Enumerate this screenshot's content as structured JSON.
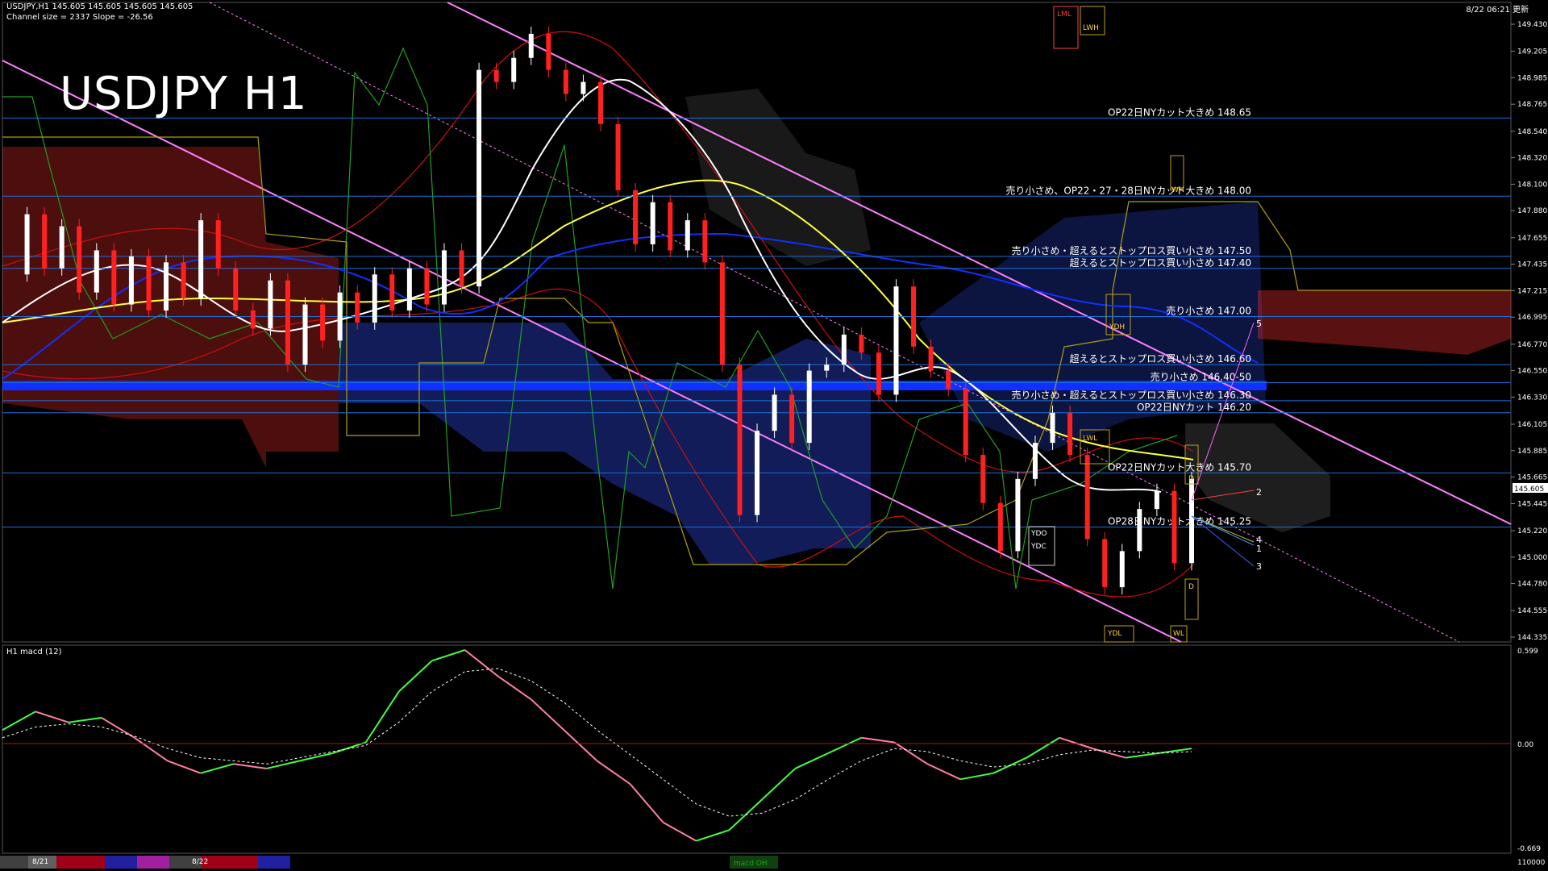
{
  "header": {
    "symbol_line": "USDJPY,H1  145.605 145.605 145.605 145.605",
    "channel_line": "Channel size = 2337 Slope = -26.56",
    "timestamp": "8/22 06:21 更新",
    "title": "USDJPY H1"
  },
  "macd_panel": {
    "label": "H1  macd (12)",
    "top_value": "0.599",
    "zero_value": "0.00",
    "bottom_value": "-0.669",
    "bottom_right": "110000"
  },
  "dates": [
    "8/21",
    "8/22"
  ],
  "strip_label": "macd OH",
  "colors": {
    "background": "#000000",
    "bull_candle": "#ffffff",
    "bear_candle": "#ff2020",
    "level_line": "#1e6fd8",
    "channel_line": "#ff80ff",
    "ma_white": "#ffffff",
    "ma_yellow": "#ffff40",
    "ma_blue": "#1030ff",
    "macd_up": "#40ff40",
    "macd_down": "#ff80a0",
    "signal": "#ffffff"
  },
  "chart_data": [
    {
      "type": "line",
      "title": "USDJPY H1",
      "y_axis_ticks": [
        "149.430",
        "149.205",
        "148.985",
        "148.765",
        "148.540",
        "148.320",
        "148.100",
        "147.880",
        "147.655",
        "147.435",
        "147.215",
        "146.995",
        "146.770",
        "146.550",
        "146.330",
        "146.105",
        "145.885",
        "145.665",
        "145.445",
        "145.220",
        "145.000",
        "144.780",
        "144.555",
        "144.335"
      ],
      "current_price": "145.605",
      "ylim": [
        144.335,
        149.43
      ],
      "price_path": [
        147.35,
        147.85,
        147.4,
        147.75,
        147.2,
        147.55,
        147.1,
        147.5,
        147.05,
        147.45,
        147.15,
        147.8,
        147.4,
        147.05,
        146.9,
        147.3,
        146.6,
        147.1,
        146.8,
        147.2,
        146.95,
        147.35,
        147.05,
        147.4,
        147.1,
        147.55,
        147.25,
        149.05,
        148.95,
        149.15,
        149.35,
        149.05,
        148.85,
        148.95,
        148.6,
        148.05,
        147.6,
        147.95,
        147.55,
        147.8,
        147.45,
        146.6,
        145.35,
        146.05,
        146.35,
        145.95,
        146.55,
        146.6,
        146.85,
        146.7,
        146.35,
        147.25,
        146.75,
        146.55,
        146.4,
        145.85,
        145.45,
        145.05,
        145.65,
        145.95,
        146.2,
        145.85,
        145.15,
        144.75,
        145.05,
        145.4,
        145.55,
        144.95,
        145.65
      ],
      "levels": [
        {
          "label": "OP22日NYカット大きめ 148.65",
          "value": 148.65
        },
        {
          "label": "売り小さめ、OP22・27・28日NYカット大きめ 148.00",
          "value": 148.0
        },
        {
          "label": "売り小さめ・超えるとストップロス買い小さめ 147.50",
          "value": 147.5
        },
        {
          "label": "超えるとストップロス買い小さめ 147.40",
          "value": 147.4
        },
        {
          "label": "売り小さめ 147.00",
          "value": 147.0
        },
        {
          "label": "超えるとストップロス買い小さめ 146.60",
          "value": 146.6
        },
        {
          "label": "売り小さめ 146.40-50",
          "value": 146.45
        },
        {
          "label": "売り小さめ・超えるとストップロス買い小さめ 146.30",
          "value": 146.3
        },
        {
          "label": "OP22日NYカット 146.20",
          "value": 146.2
        },
        {
          "label": "OP22日NYカット大きめ 145.70",
          "value": 145.7
        },
        {
          "label": "OP28日NYカット大きめ 145.25",
          "value": 145.25
        }
      ],
      "markers": [
        "LML",
        "LWH",
        "WH",
        "YDH",
        "LWL",
        "YDO",
        "YDC",
        "YDL",
        "WL",
        "D",
        "D"
      ],
      "projection_labels": [
        "1",
        "2",
        "3",
        "4",
        "5"
      ]
    },
    {
      "type": "line",
      "title": "H1  macd (12)",
      "ylim": [
        -0.669,
        0.599
      ],
      "macd_path": [
        0.1,
        0.22,
        0.15,
        0.18,
        0.05,
        -0.1,
        -0.18,
        -0.12,
        -0.15,
        -0.1,
        -0.05,
        0.02,
        0.35,
        0.55,
        0.62,
        0.45,
        0.3,
        0.1,
        -0.1,
        -0.25,
        -0.5,
        -0.62,
        -0.55,
        -0.35,
        -0.15,
        -0.05,
        0.05,
        0.02,
        -0.12,
        -0.22,
        -0.18,
        -0.08,
        0.05,
        -0.02,
        -0.08,
        -0.05,
        -0.02
      ],
      "signal_path": [
        0.05,
        0.12,
        0.14,
        0.12,
        0.06,
        -0.02,
        -0.08,
        -0.1,
        -0.12,
        -0.08,
        -0.04,
        0.0,
        0.15,
        0.35,
        0.48,
        0.5,
        0.42,
        0.28,
        0.1,
        -0.06,
        -0.22,
        -0.38,
        -0.46,
        -0.44,
        -0.35,
        -0.22,
        -0.1,
        -0.02,
        -0.04,
        -0.1,
        -0.14,
        -0.12,
        -0.06,
        -0.03,
        -0.04,
        -0.05,
        -0.04
      ]
    }
  ]
}
